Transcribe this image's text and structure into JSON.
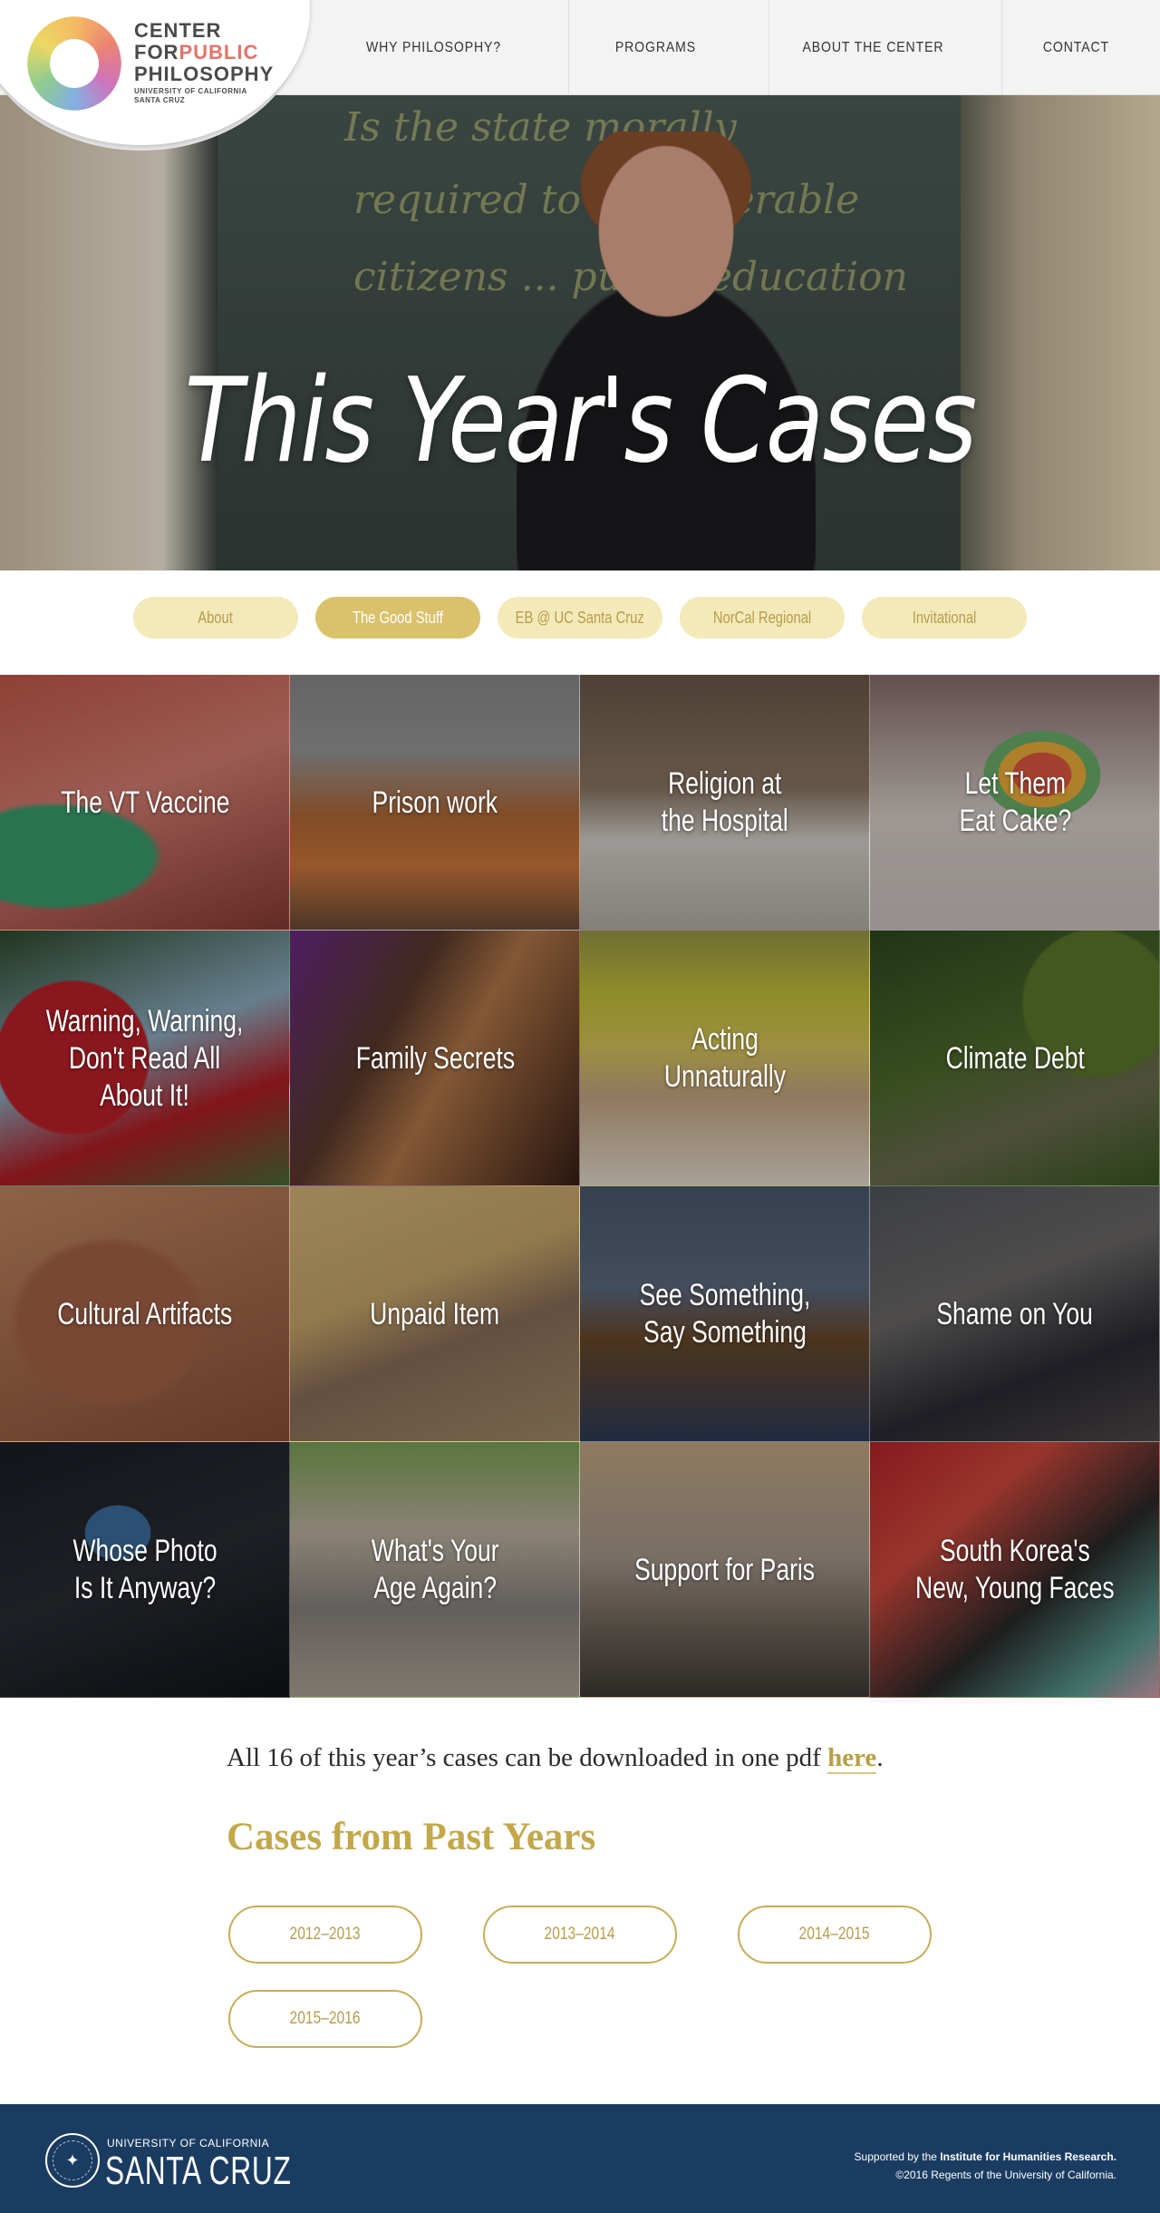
{
  "header": {
    "logo": {
      "line1": "CENTER",
      "line2a": "FOR",
      "line2b": "PUBLIC",
      "line3": "PHILOSOPHY",
      "sub1": "UNIVERSITY OF CALIFORNIA",
      "sub2": "SANTA CRUZ"
    },
    "nav": [
      "WHY PHILOSOPHY?",
      "PROGRAMS",
      "ABOUT THE CENTER",
      "CONTACT"
    ]
  },
  "hero": {
    "title": "This Year's Cases",
    "chalk": [
      "Is the state morally",
      "required to ... vulnerable",
      "citizens ... public education"
    ]
  },
  "subnav": {
    "items": [
      "About",
      "The Good Stuff",
      "EB @ UC Santa Cruz",
      "NorCal Regional",
      "Invitational"
    ],
    "active": "The Good Stuff"
  },
  "cases": [
    "The VT Vaccine",
    "Prison work",
    "Religion at\nthe Hospital",
    "Let Them\nEat Cake?",
    "Warning, Warning,\nDon't Read All\nAbout It!",
    "Family Secrets",
    "Acting\nUnnaturally",
    "Climate Debt",
    "Cultural Artifacts",
    "Unpaid Item",
    "See Something,\nSay Something",
    "Shame on You",
    "Whose Photo\nIs It Anyway?",
    "What's Your\nAge Again?",
    "Support for Paris",
    "South Korea's\nNew, Young Faces"
  ],
  "download": {
    "text": "All 16 of this year’s cases can be downloaded in one pdf ",
    "link": "here",
    "end": "."
  },
  "past": {
    "heading": "Cases from Past Years",
    "years": [
      "2012–2013",
      "2013–2014",
      "2014–2015",
      "2015–2016"
    ]
  },
  "footer": {
    "uc_small": "UNIVERSITY OF CALIFORNIA",
    "uc_big": "SANTA CRUZ",
    "supported_prefix": "Supported by the ",
    "supported_name": "Institute for Humanities Research.",
    "copyright": "©2016 Regents of the University of California."
  },
  "colors": {
    "gold": "#c2a84b",
    "pill": "#f4e9b8",
    "pill_active": "#d9c26b",
    "footer": "#1b3c61",
    "public_accent": "#e5736a"
  }
}
